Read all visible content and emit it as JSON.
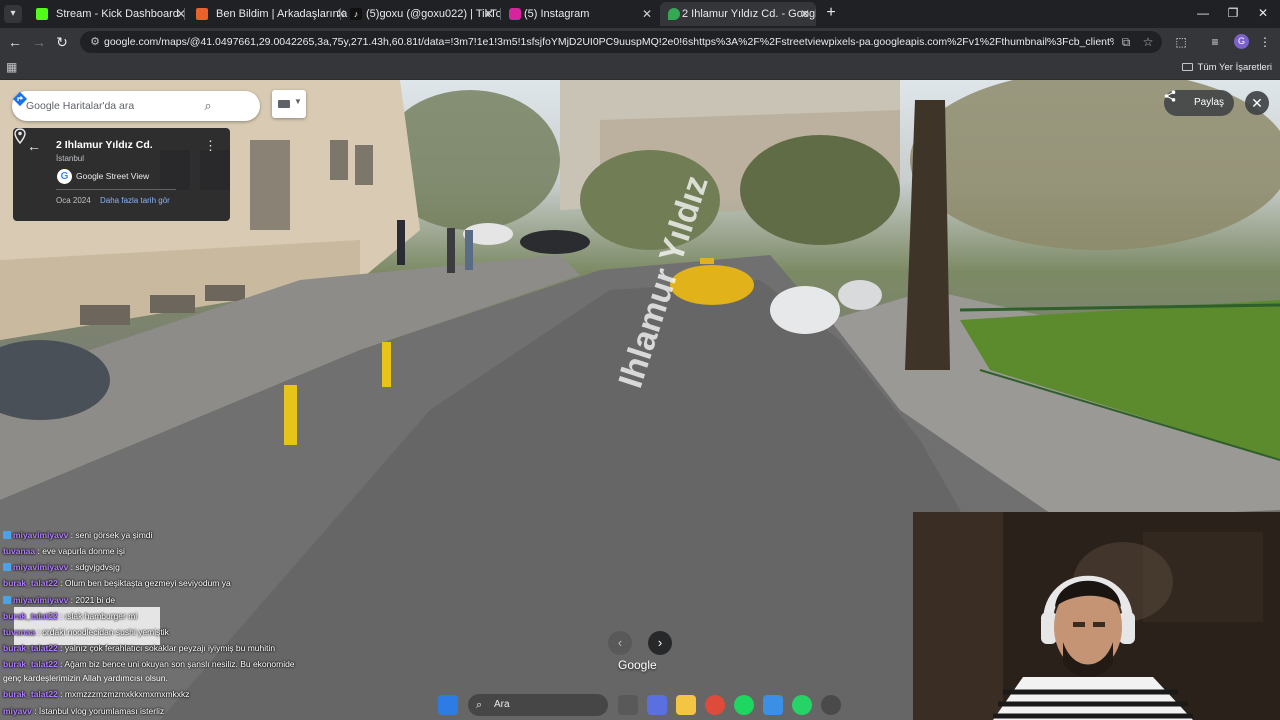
{
  "browser": {
    "tabs": [
      {
        "title": "Stream - Kick Dashboard",
        "favicon_color": "#53fc18",
        "icon": "kick-icon",
        "active": false
      },
      {
        "title": "Ben Bildim | Arkadaşlarınla Onli",
        "favicon_color": "#e8622c",
        "icon": "benbildim-icon",
        "active": false
      },
      {
        "title": "(5)goxu (@goxu022) | TikTok",
        "favicon_color": "#111111",
        "icon": "tiktok-icon",
        "active": false
      },
      {
        "title": "(5) Instagram",
        "favicon_color": "#d6249f",
        "icon": "instagram-icon",
        "active": false
      },
      {
        "title": "2 Ihlamur Yıldız Cd. - Google H",
        "favicon_color": "#34a853",
        "icon": "google-maps-icon",
        "active": true
      }
    ],
    "url": "google.com/maps/@41.0497661,29.0042265,3a,75y,271.43h,60.81t/data=!3m7!1e1!3m5!1sfsjfoYMjD2UI0PC9uuspMQ!2e0!6shttps%3A%2F%2Fstreetviewpixels-pa.googleapis.com%2Fv1%2Fthumbnail%3Fcb_client%3Dmaps_sv.tactile%26w%3D900...",
    "bookmarks_all_label": "Tüm Yer İşaretleri",
    "profile_initial": "G"
  },
  "maps": {
    "search_placeholder": "Google Haritalar'da ara",
    "place_title": "2 Ihlamur Yıldız Cd.",
    "place_city": "İstanbul",
    "source_label": "Google Street View",
    "capture_date": "Oca 2024",
    "history_link": "Daha fazla tarih gör",
    "share_label": "Paylaş",
    "street_label": "Ihlamur Yıldız",
    "brand": "Google"
  },
  "chat": {
    "messages": [
      {
        "user": "miyavimiyavv",
        "text": " : seni görsek ya şimdi",
        "color": "#b07cff",
        "badge": true
      },
      {
        "user": "tuvanaa",
        "text": " : eve vapurla donme işi",
        "color": "#b07cff",
        "badge": false
      },
      {
        "user": "miyavimiyavv",
        "text": " : sdgvjgdvsjg",
        "color": "#b07cff",
        "badge": true
      },
      {
        "user": "burak_talat22",
        "text": " : Olum ben beşiktaşta gezmeyi seviyodum ya",
        "color": "#b07cff",
        "badge": false
      },
      {
        "user": "miyavimiyavv",
        "text": " : 2021 bi de",
        "color": "#b07cff",
        "badge": true
      },
      {
        "user": "burak_talat22",
        "text": " : ıslak hamburger mi",
        "color": "#b07cff",
        "badge": false
      },
      {
        "user": "tuvanaa",
        "text": " : ordaki noodlecidan sushi yemiştik",
        "color": "#b07cff",
        "badge": false
      },
      {
        "user": "burak_talat22",
        "text": " : yalnız çok ferahlatıcı sokaklar peyzajı iyiymiş bu muhitin",
        "color": "#b07cff",
        "badge": false
      },
      {
        "user": "burak_talat22",
        "text": " : Ağam biz bence uni okuyan son şanslı nesiliz. Bu ekonomide",
        "color": "#b07cff",
        "badge": false
      },
      {
        "user": "",
        "text": "genç kardeşlerimizin Allah yardımcısı olsun.",
        "color": "#ffffff",
        "badge": false
      },
      {
        "user": "burak_talat22",
        "text": " : mxmzzzmzmzmxkkxmxmxmkxkz",
        "color": "#b07cff",
        "badge": false
      },
      {
        "user": "miyavv",
        "text": " : İstanbul vlog yorumlaması isterliz",
        "color": "#b07cff",
        "badge": false
      }
    ]
  },
  "taskbar": {
    "search_label": "Ara"
  }
}
